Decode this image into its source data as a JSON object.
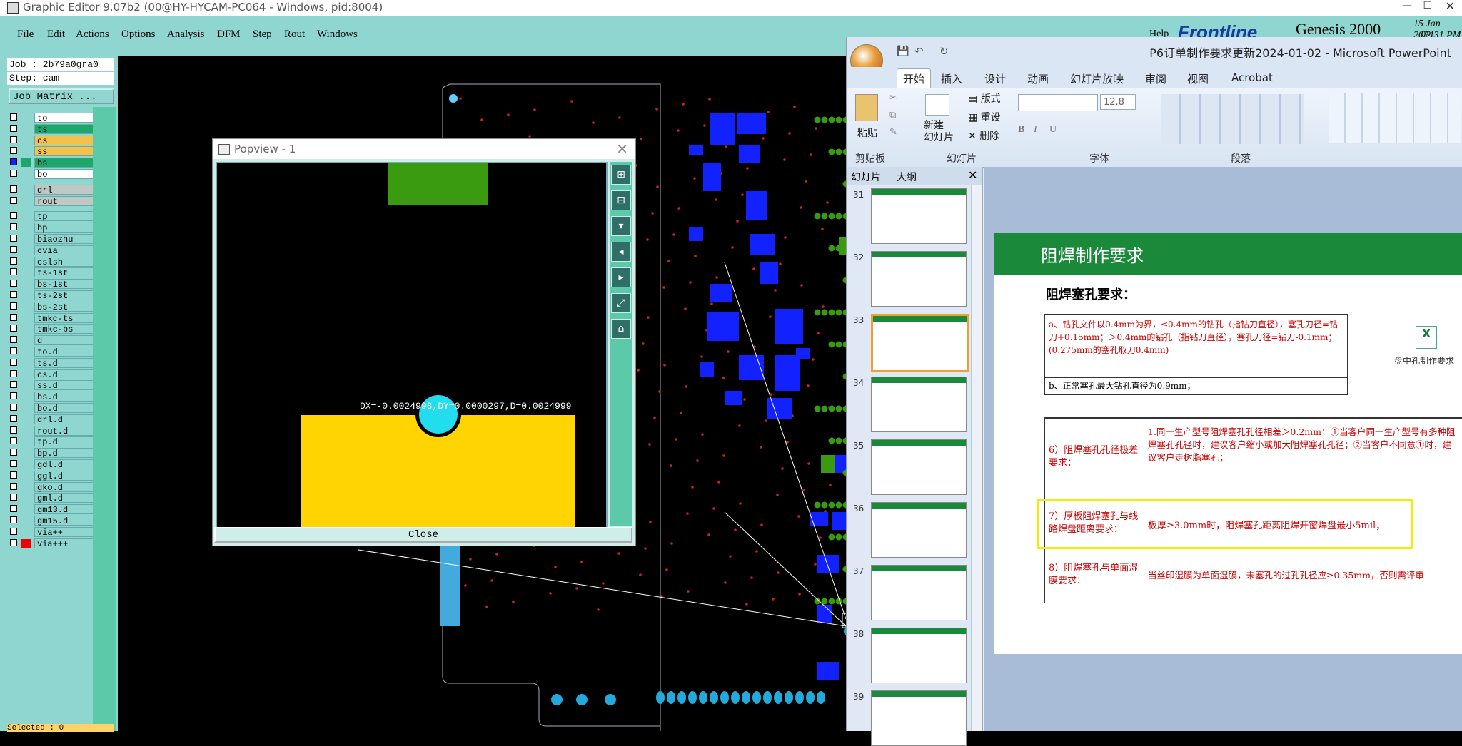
{
  "genesis": {
    "title": "Graphic Editor 9.07b2 (00@HY-HYCAM-PC064 - Windows, pid:8004)",
    "menu": [
      "File",
      "Edit",
      "Actions",
      "Options",
      "Analysis",
      "DFM",
      "Step",
      "Rout",
      "Windows"
    ],
    "help": "Help",
    "brand": "Frontline",
    "product": "Genesis 2000",
    "date": "15 Jan 2024",
    "time": "02:31 PM",
    "job": "Job : 2b79a0gra0",
    "step": "Step: cam",
    "job_matrix": "Job Matrix ...",
    "layers": [
      {
        "name": "to",
        "color": "#ffffff"
      },
      {
        "name": "ts",
        "color": "#1fa66a"
      },
      {
        "name": "cs",
        "color": "#f6c14a"
      },
      {
        "name": "ss",
        "color": "#f6c14a"
      },
      {
        "name": "bs",
        "color": "#1fa66a"
      },
      {
        "name": "bo",
        "color": "#ffffff"
      },
      {
        "name": "drl",
        "color": "#bfc7c7"
      },
      {
        "name": "rout",
        "color": "#bfc7c7"
      },
      {
        "name": "tp",
        "color": "#8fd6d0"
      },
      {
        "name": "bp",
        "color": "#8fd6d0"
      },
      {
        "name": "biaozhu",
        "color": "#8fd6d0"
      },
      {
        "name": "cvia",
        "color": "#8fd6d0"
      },
      {
        "name": "cslsh",
        "color": "#8fd6d0"
      },
      {
        "name": "ts-1st",
        "color": "#8fd6d0"
      },
      {
        "name": "bs-1st",
        "color": "#8fd6d0"
      },
      {
        "name": "ts-2st",
        "color": "#8fd6d0"
      },
      {
        "name": "bs-2st",
        "color": "#8fd6d0"
      },
      {
        "name": "tmkc-ts",
        "color": "#8fd6d0"
      },
      {
        "name": "tmkc-bs",
        "color": "#8fd6d0"
      },
      {
        "name": "d",
        "color": "#8fd6d0"
      },
      {
        "name": "to.d",
        "color": "#8fd6d0"
      },
      {
        "name": "ts.d",
        "color": "#8fd6d0"
      },
      {
        "name": "cs.d",
        "color": "#8fd6d0"
      },
      {
        "name": "ss.d",
        "color": "#8fd6d0"
      },
      {
        "name": "bs.d",
        "color": "#8fd6d0"
      },
      {
        "name": "bo.d",
        "color": "#8fd6d0"
      },
      {
        "name": "drl.d",
        "color": "#8fd6d0"
      },
      {
        "name": "rout.d",
        "color": "#8fd6d0"
      },
      {
        "name": "tp.d",
        "color": "#8fd6d0"
      },
      {
        "name": "bp.d",
        "color": "#8fd6d0"
      },
      {
        "name": "gdl.d",
        "color": "#8fd6d0"
      },
      {
        "name": "ggl.d",
        "color": "#8fd6d0"
      },
      {
        "name": "gko.d",
        "color": "#8fd6d0"
      },
      {
        "name": "gml.d",
        "color": "#8fd6d0"
      },
      {
        "name": "gm13.d",
        "color": "#8fd6d0"
      },
      {
        "name": "gm15.d",
        "color": "#8fd6d0"
      },
      {
        "name": "via++",
        "color": "#8fd6d0"
      },
      {
        "name": "via+++",
        "color": "#8fd6d0"
      }
    ],
    "selected": "Selected : 0"
  },
  "popview": {
    "title": "Popview - 1",
    "measure": "DX=-0.0024998,DY=0.0000297,D=0.0024999",
    "close": "Close"
  },
  "ppt": {
    "title": "P6订单制作要求更新2024-01-02 - Microsoft PowerPoint",
    "tabs": [
      "开始",
      "插入",
      "设计",
      "动画",
      "幻灯片放映",
      "审阅",
      "视图",
      "Acrobat"
    ],
    "groups": [
      "剪贴板",
      "幻灯片",
      "字体",
      "段落"
    ],
    "paste": "粘贴",
    "new_slide": "新建\n幻灯片",
    "layout": "版式",
    "reset": "重设",
    "delete": "删除",
    "font_size": "12.8",
    "pane_tabs": [
      "幻灯片",
      "大纲"
    ],
    "slide_numbers": [
      "31",
      "32",
      "33",
      "34",
      "35",
      "36",
      "37",
      "38",
      "39"
    ],
    "slide": {
      "header": "阻焊制作要求",
      "subtitle": "阻焊塞孔要求：",
      "line_a": "a、钻孔文件以0.4mm为界，≤0.4mm的钻孔（指钻刀直径），塞孔刀径=钻刀+0.15mm；＞0.4mm的钻孔（指钻刀直径），塞孔刀径=钻刀-0.1mm；(0.275mm的塞孔取刀0.4mm)",
      "line_b": "b、正常塞孔最大钻孔直径为0.9mm；",
      "embed_label": "盘中孔制作要求",
      "row6_label": "6）阻焊塞孔孔径极差要求：",
      "row6_text": "1.同一生产型号阻焊塞孔孔径相差＞0.2mm；①当客户同一生产型号有多种阻焊塞孔孔径时，建议客户缩小或加大阻焊塞孔孔径；②当客户不同意①时，建议客户走树脂塞孔；",
      "row7_label": "7）厚板阻焊塞孔与线路焊盘距离要求：",
      "row7_text": "板厚≥3.0mm时，阻焊塞孔距离阻焊开窗焊盘最小5mil；",
      "row8_label": "8）阻焊塞孔与单面湿膜要求：",
      "row8_text": "当丝印湿膜为单面湿膜，未塞孔的过孔孔径应≥0.35mm，否则需评审"
    }
  }
}
